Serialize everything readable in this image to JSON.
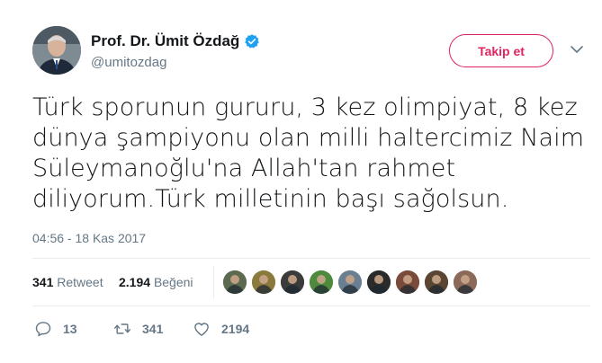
{
  "user": {
    "display_name": "Prof. Dr. Ümit Özdağ",
    "handle": "@umitozdag",
    "verified": true
  },
  "follow_button": {
    "label": "Takip et"
  },
  "tweet": {
    "text_lines": [
      "Türk sporunun gururu, 3 kez olimpiyat, 8 kez",
      "dünya şampiyonu olan milli haltercimiz Naim",
      "Süleymanoğlu'na Allah'tan rahmet",
      "diliyorum.Türk milletinin başı sağolsun."
    ],
    "timestamp": "04:56 - 18 Kas 2017"
  },
  "stats": {
    "retweets_count": "341",
    "retweets_label": "Retweet",
    "likes_count": "2.194",
    "likes_label": "Beğeni"
  },
  "likers": [
    {
      "icon": "avatar-icon",
      "color": "#5c6b4f"
    },
    {
      "icon": "avatar-icon",
      "color": "#8a7a3c"
    },
    {
      "icon": "avatar-icon",
      "color": "#3b3b3b"
    },
    {
      "icon": "avatar-icon",
      "color": "#4e8a3e"
    },
    {
      "icon": "avatar-icon",
      "color": "#6a7f92"
    },
    {
      "icon": "avatar-icon",
      "color": "#2b2b2b"
    },
    {
      "icon": "avatar-icon",
      "color": "#7a4a3a"
    },
    {
      "icon": "avatar-icon",
      "color": "#5a4632"
    },
    {
      "icon": "avatar-icon",
      "color": "#8c6a5a"
    }
  ],
  "actions": {
    "reply_count": "13",
    "retweet_count": "341",
    "like_count": "2194"
  },
  "colors": {
    "accent_red": "#e0245e",
    "verified_blue": "#1da1f2",
    "muted": "#657786"
  }
}
